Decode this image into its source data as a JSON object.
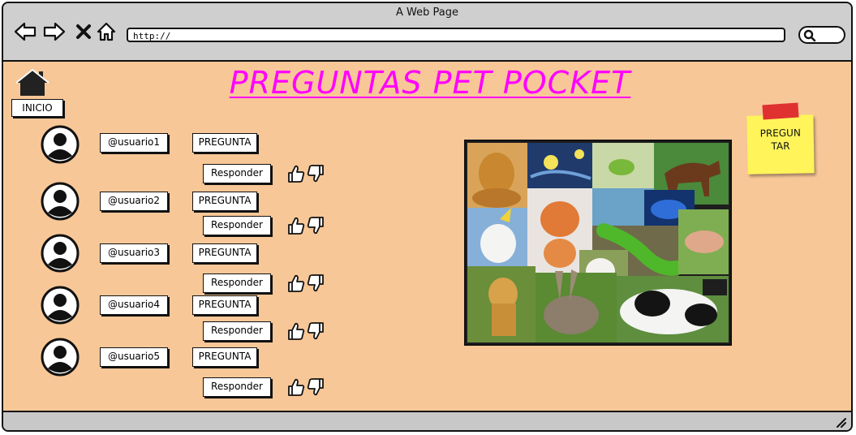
{
  "window": {
    "title": "A Web Page"
  },
  "browser": {
    "url": "http://"
  },
  "page": {
    "title": "PREGUNTAS PET POCKET",
    "home_label": "INICIO",
    "ask_note": "PREGUN\nTAR"
  },
  "questions": [
    {
      "user": "@usuario1",
      "question_label": "PREGUNTA",
      "reply_label": "Responder"
    },
    {
      "user": "@usuario2",
      "question_label": "PREGUNTA",
      "reply_label": "Responder"
    },
    {
      "user": "@usuario3",
      "question_label": "PREGUNTA",
      "reply_label": "Responder"
    },
    {
      "user": "@usuario4",
      "question_label": "PREGUNTA",
      "reply_label": "Responder"
    },
    {
      "user": "@usuario5",
      "question_label": "PREGUNTA",
      "reply_label": "Responder"
    }
  ],
  "colors": {
    "background": "#f8c797",
    "title": "#ff00ff",
    "sticky": "#fff45a",
    "sticky_tape": "#e03131"
  },
  "icons": [
    "back-arrow-icon",
    "forward-arrow-icon",
    "close-icon",
    "home-icon",
    "search-icon",
    "avatar-icon",
    "thumbs-up-icon",
    "thumbs-down-icon",
    "resize-icon"
  ]
}
